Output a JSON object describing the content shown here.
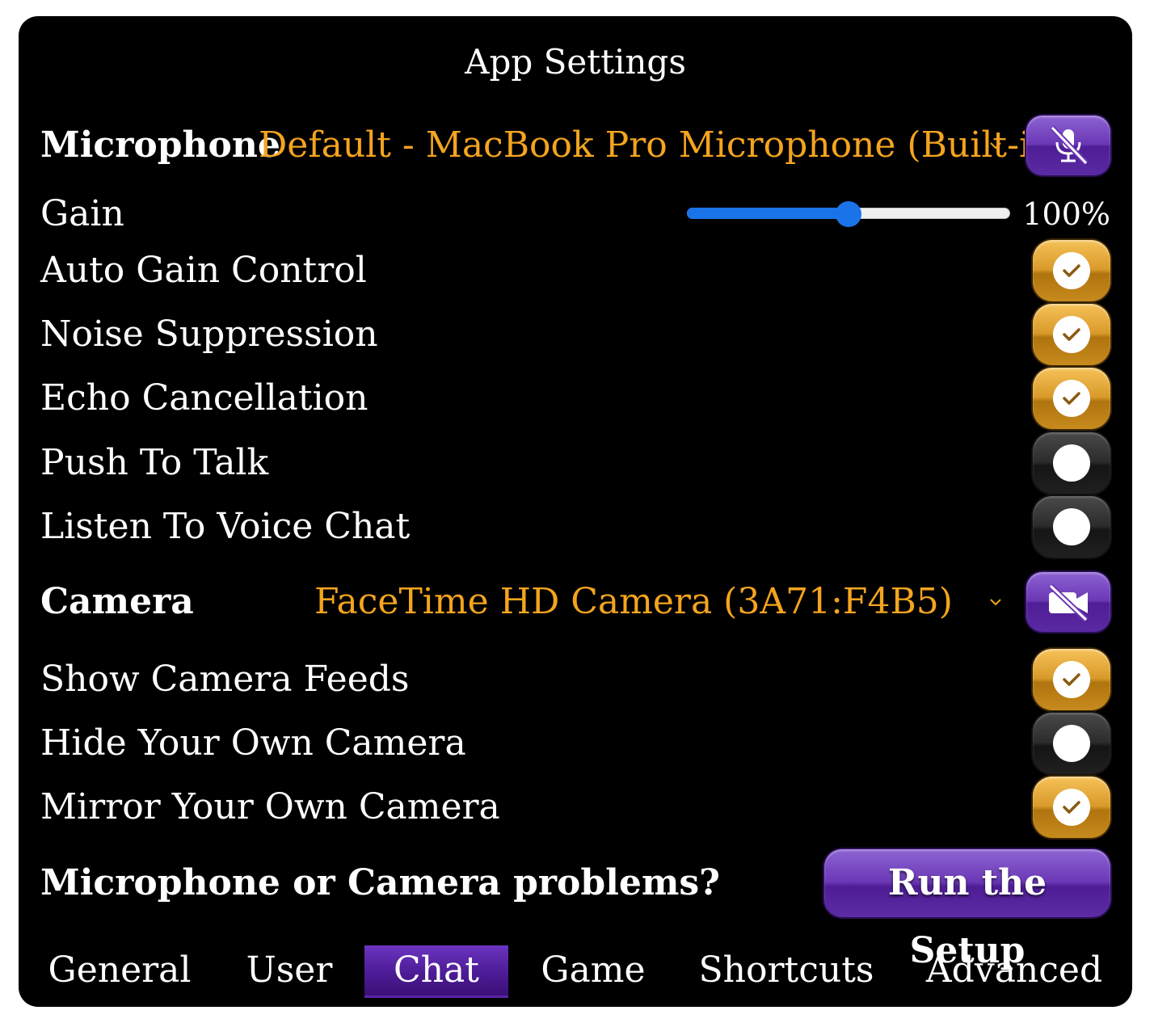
{
  "window": {
    "title": "App Settings"
  },
  "microphone": {
    "label": "Microphone",
    "device": "Default - MacBook Pro Microphone (Built-in)",
    "mute_icon": "microphone-muted-icon"
  },
  "gain": {
    "label": "Gain",
    "value_text": "100%",
    "slider_fraction": 0.5
  },
  "audio_options": [
    {
      "label": "Auto Gain Control",
      "enabled": true
    },
    {
      "label": "Noise Suppression",
      "enabled": true
    },
    {
      "label": "Echo Cancellation",
      "enabled": true
    },
    {
      "label": "Push To Talk",
      "enabled": false
    },
    {
      "label": "Listen To Voice Chat",
      "enabled": false
    }
  ],
  "camera": {
    "label": "Camera",
    "device": "FaceTime HD Camera (3A71:F4B5)",
    "mute_icon": "camera-off-icon"
  },
  "camera_options": [
    {
      "label": "Show Camera Feeds",
      "enabled": true
    },
    {
      "label": "Hide Your Own Camera",
      "enabled": false
    },
    {
      "label": "Mirror Your Own Camera",
      "enabled": true
    }
  ],
  "setup": {
    "prompt": "Microphone or Camera problems?",
    "button_label": "Run the Setup"
  },
  "tabs": [
    {
      "label": "General",
      "active": false
    },
    {
      "label": "User",
      "active": false
    },
    {
      "label": "Chat",
      "active": true
    },
    {
      "label": "Game",
      "active": false
    },
    {
      "label": "Shortcuts",
      "active": false
    },
    {
      "label": "Advanced",
      "active": false
    }
  ],
  "colors": {
    "accent_orange": "#f4a41e",
    "toggle_on": "#d89a2a",
    "button_purple": "#6a37b5",
    "slider_blue": "#1a73e8"
  }
}
